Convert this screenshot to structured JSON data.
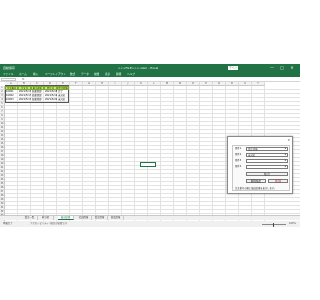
{
  "titlebar": {
    "autosave": "自動保存",
    "title": "<<<FILE>>>.xlsm - Excel",
    "signin": "サイン",
    "min": "—",
    "max": "□",
    "close": "✕"
  },
  "ribbon": {
    "tabs": [
      "ファイル",
      "ホーム",
      "挿入",
      "ページレイアウト",
      "数式",
      "データ",
      "校閲",
      "表示",
      "開発",
      "ヘルプ"
    ]
  },
  "formula": {
    "name_box": "",
    "fx": "fx"
  },
  "grid": {
    "columns": [
      "A",
      "B",
      "C",
      "D",
      "E",
      "F",
      "G",
      "H",
      "I",
      "J",
      "K",
      "L",
      "M",
      "N",
      "O",
      "P",
      "Q",
      "R",
      "S",
      "T"
    ],
    "rows": [
      "1",
      "2",
      "3",
      "4",
      "5",
      "6",
      "7",
      "8",
      "9",
      "10",
      "11",
      "12",
      "13",
      "14",
      "15",
      "16",
      "17",
      "18",
      "19",
      "20",
      "21",
      "22",
      "23",
      "24",
      "25",
      "26",
      "27",
      "28",
      "29",
      "30",
      "31",
      "32",
      "33",
      "34"
    ]
  },
  "table": {
    "headers": [
      "注文番号",
      "注文日",
      "担当者名",
      "受注日",
      "受注状態"
    ],
    "rows": [
      [
        "10001",
        "2021/5/17",
        "佐藤四郎",
        "2021/5/18",
        "完了"
      ],
      [
        "10002",
        "2021/5/17",
        "佐藤四郎",
        "2021/5/19",
        "未対応"
      ],
      [
        "10003",
        "2021/5/17",
        "佐藤四郎",
        "2021/5/20",
        "未対応"
      ]
    ]
  },
  "dialog": {
    "close": "✕",
    "fields": [
      {
        "label": "条件1",
        "value": "受注状態"
      },
      {
        "label": "条件2",
        "value": "未対応"
      },
      {
        "label": "条件3",
        "value": ""
      },
      {
        "label": "条件4",
        "value": ""
      }
    ],
    "extract_label": "抽 出",
    "reset_label": "解除抽出",
    "delete_label": "削 除",
    "note": "注文番号の順に抽出結果を表示します。"
  },
  "sheet_tabs": [
    "受注一覧",
    "担当者",
    "抽出結果",
    "社員情報",
    "受注情報",
    "商品情報"
  ],
  "active_tab_index": 2,
  "status": {
    "ready": "準備完了",
    "accessibility": "アクセシビリティ: 検討が必要です",
    "zoom": "100%"
  }
}
